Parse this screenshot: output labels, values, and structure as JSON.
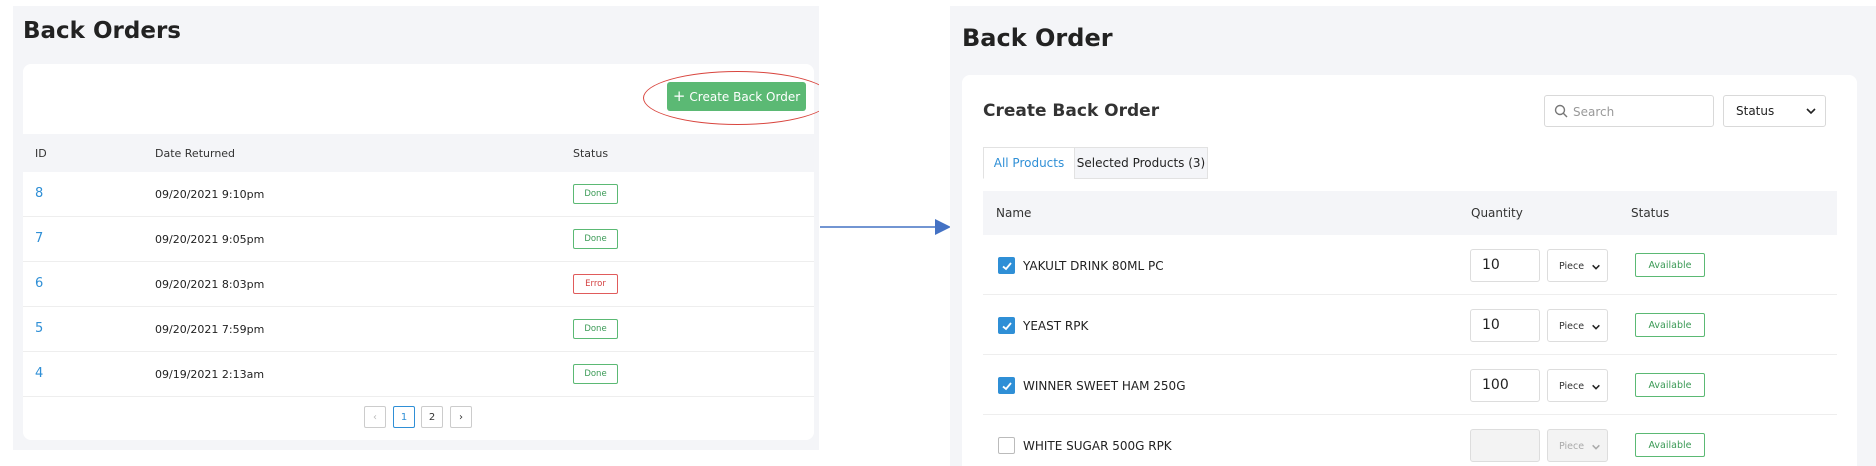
{
  "left": {
    "title": "Back Orders",
    "create_button": "Create Back Order",
    "columns": [
      "ID",
      "Date Returned",
      "Status"
    ],
    "rows": [
      {
        "id": "8",
        "date": "09/20/2021 9:10pm",
        "status": "Done"
      },
      {
        "id": "7",
        "date": "09/20/2021 9:05pm",
        "status": "Done"
      },
      {
        "id": "6",
        "date": "09/20/2021 8:03pm",
        "status": "Error"
      },
      {
        "id": "5",
        "date": "09/20/2021 7:59pm",
        "status": "Done"
      },
      {
        "id": "4",
        "date": "09/19/2021 2:13am",
        "status": "Done"
      }
    ],
    "pagination": {
      "prev": "‹",
      "pages": [
        "1",
        "2"
      ],
      "next": "›",
      "current": "1"
    }
  },
  "right": {
    "title": "Back Order",
    "card_title": "Create Back Order",
    "search_placeholder": "Search",
    "status_select": "Status",
    "tabs": [
      "All Products",
      "Selected Products (3)"
    ],
    "columns": [
      "Name",
      "Quantity",
      "Status"
    ],
    "rows": [
      {
        "checked": true,
        "name": "YAKULT DRINK 80ML PC",
        "quantity": "10",
        "unit": "Piece",
        "status": "Available"
      },
      {
        "checked": true,
        "name": "YEAST RPK",
        "quantity": "10",
        "unit": "Piece",
        "status": "Available"
      },
      {
        "checked": true,
        "name": "WINNER SWEET HAM 250G",
        "quantity": "100",
        "unit": "Piece",
        "status": "Available"
      },
      {
        "checked": false,
        "name": "WHITE SUGAR 500G RPK",
        "quantity": "",
        "unit": "Piece",
        "status": "Available"
      }
    ]
  },
  "colors": {
    "accent_blue": "#2f8fd6",
    "success_green": "#5bb974",
    "error_red": "#d34040",
    "highlight_red": "#d9463f",
    "arrow_blue": "#4472c4"
  }
}
